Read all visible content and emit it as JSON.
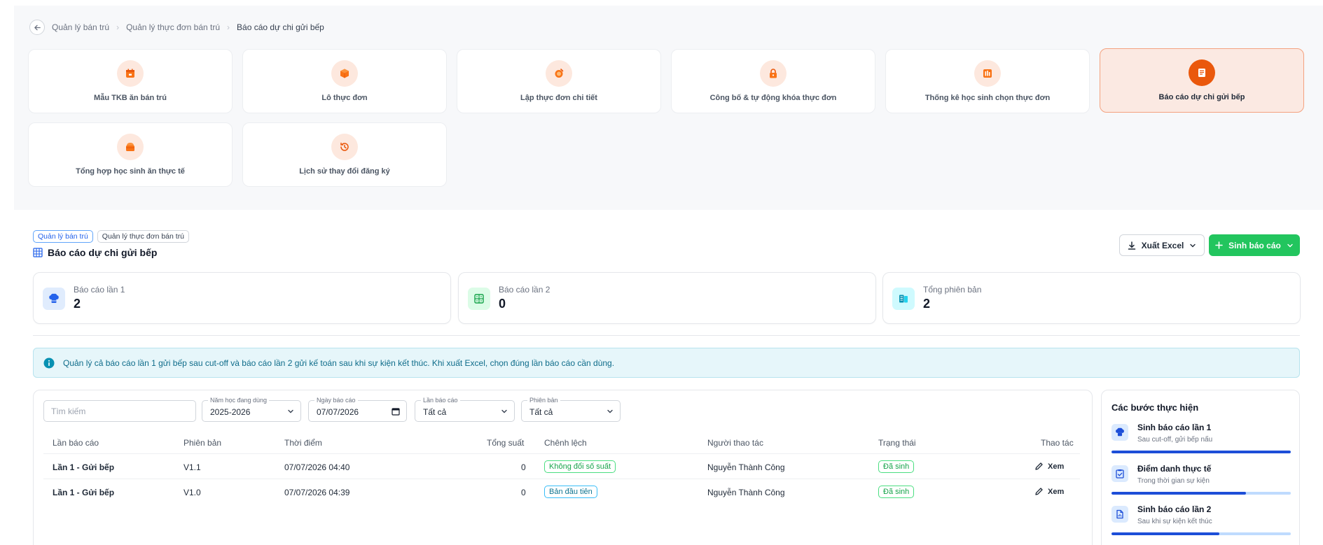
{
  "breadcrumb": {
    "items": [
      "Quản lý bán trú",
      "Quản lý thực đơn bán trú",
      "Báo cáo dự chi gửi bếp"
    ]
  },
  "modules": [
    {
      "label": "Mẫu TKB ăn bán trú",
      "icon": "calendar-icon"
    },
    {
      "label": "Lô thực đơn",
      "icon": "box-icon"
    },
    {
      "label": "Lập thực đơn chi tiết",
      "icon": "food-icon"
    },
    {
      "label": "Công bố & tự động khóa thực đơn",
      "icon": "lock-icon"
    },
    {
      "label": "Thống kê học sinh chọn thực đơn",
      "icon": "chart-bars-icon"
    },
    {
      "label": "Báo cáo dự chi gửi bếp",
      "icon": "report-icon",
      "active": true
    },
    {
      "label": "Tổng hợp học sinh ăn thực tế",
      "icon": "lunchbox-icon"
    },
    {
      "label": "Lịch sử thay đổi đăng ký",
      "icon": "history-icon"
    }
  ],
  "header": {
    "tags": [
      "Quản lý bán trú",
      "Quản lý thực đơn bán trú"
    ],
    "title": "Báo cáo dự chi gửi bếp",
    "export_label": "Xuất Excel",
    "generate_label": "Sinh báo cáo"
  },
  "stats": [
    {
      "label": "Báo cáo lần 1",
      "value": "2",
      "icon": "chef-hat-icon",
      "color": "#2563eb"
    },
    {
      "label": "Báo cáo lần 2",
      "value": "0",
      "icon": "grid-icon",
      "color": "#16a34a"
    },
    {
      "label": "Tổng phiên bản",
      "value": "2",
      "icon": "files-icon",
      "color": "#0891b2"
    }
  ],
  "info": {
    "text": "Quản lý cả báo cáo lần 1 gửi bếp sau cut-off và báo cáo lần 2 gửi kế toán sau khi sự kiện kết thúc. Khi xuất Excel, chọn đúng lần báo cáo cần dùng."
  },
  "filters": {
    "search_placeholder": "Tìm kiếm",
    "school_year": {
      "label": "Năm học đang dùng",
      "value": "2025-2026"
    },
    "report_date": {
      "label": "Ngày báo cáo",
      "value": "07/07/2026"
    },
    "report_round": {
      "label": "Lần báo cáo",
      "value": "Tất cả"
    },
    "version": {
      "label": "Phiên bản",
      "value": "Tất cả"
    }
  },
  "table": {
    "columns": [
      "Lần báo cáo",
      "Phiên bản",
      "Thời điểm",
      "Tổng suất",
      "Chênh lệch",
      "Người thao tác",
      "Trạng thái",
      "Thao tác"
    ],
    "rows": [
      {
        "round": "Lần 1 - Gửi bếp",
        "version": "V1.1",
        "time": "07/07/2026 04:40",
        "total": "0",
        "diff": "Không đổi số suất",
        "user": "Nguyễn Thành Công",
        "status": "Đã sinh",
        "action": "Xem"
      },
      {
        "round": "Lần 1 - Gửi bếp",
        "version": "V1.0",
        "time": "07/07/2026 04:39",
        "total": "0",
        "diff": "Bản đầu tiên",
        "user": "Nguyễn Thành Công",
        "status": "Đã sinh",
        "action": "Xem"
      }
    ]
  },
  "steps": {
    "title": "Các bước thực hiện",
    "items": [
      {
        "title": "Sinh báo cáo lần 1",
        "subtitle": "Sau cut-off, gửi bếp nấu",
        "progress": 1.0
      },
      {
        "title": "Điểm danh thực tế",
        "subtitle": "Trong thời gian sự kiện",
        "progress": 0.75
      },
      {
        "title": "Sinh báo cáo lần 2",
        "subtitle": "Sau khi sự kiện kết thúc",
        "progress": 0.6
      }
    ]
  }
}
